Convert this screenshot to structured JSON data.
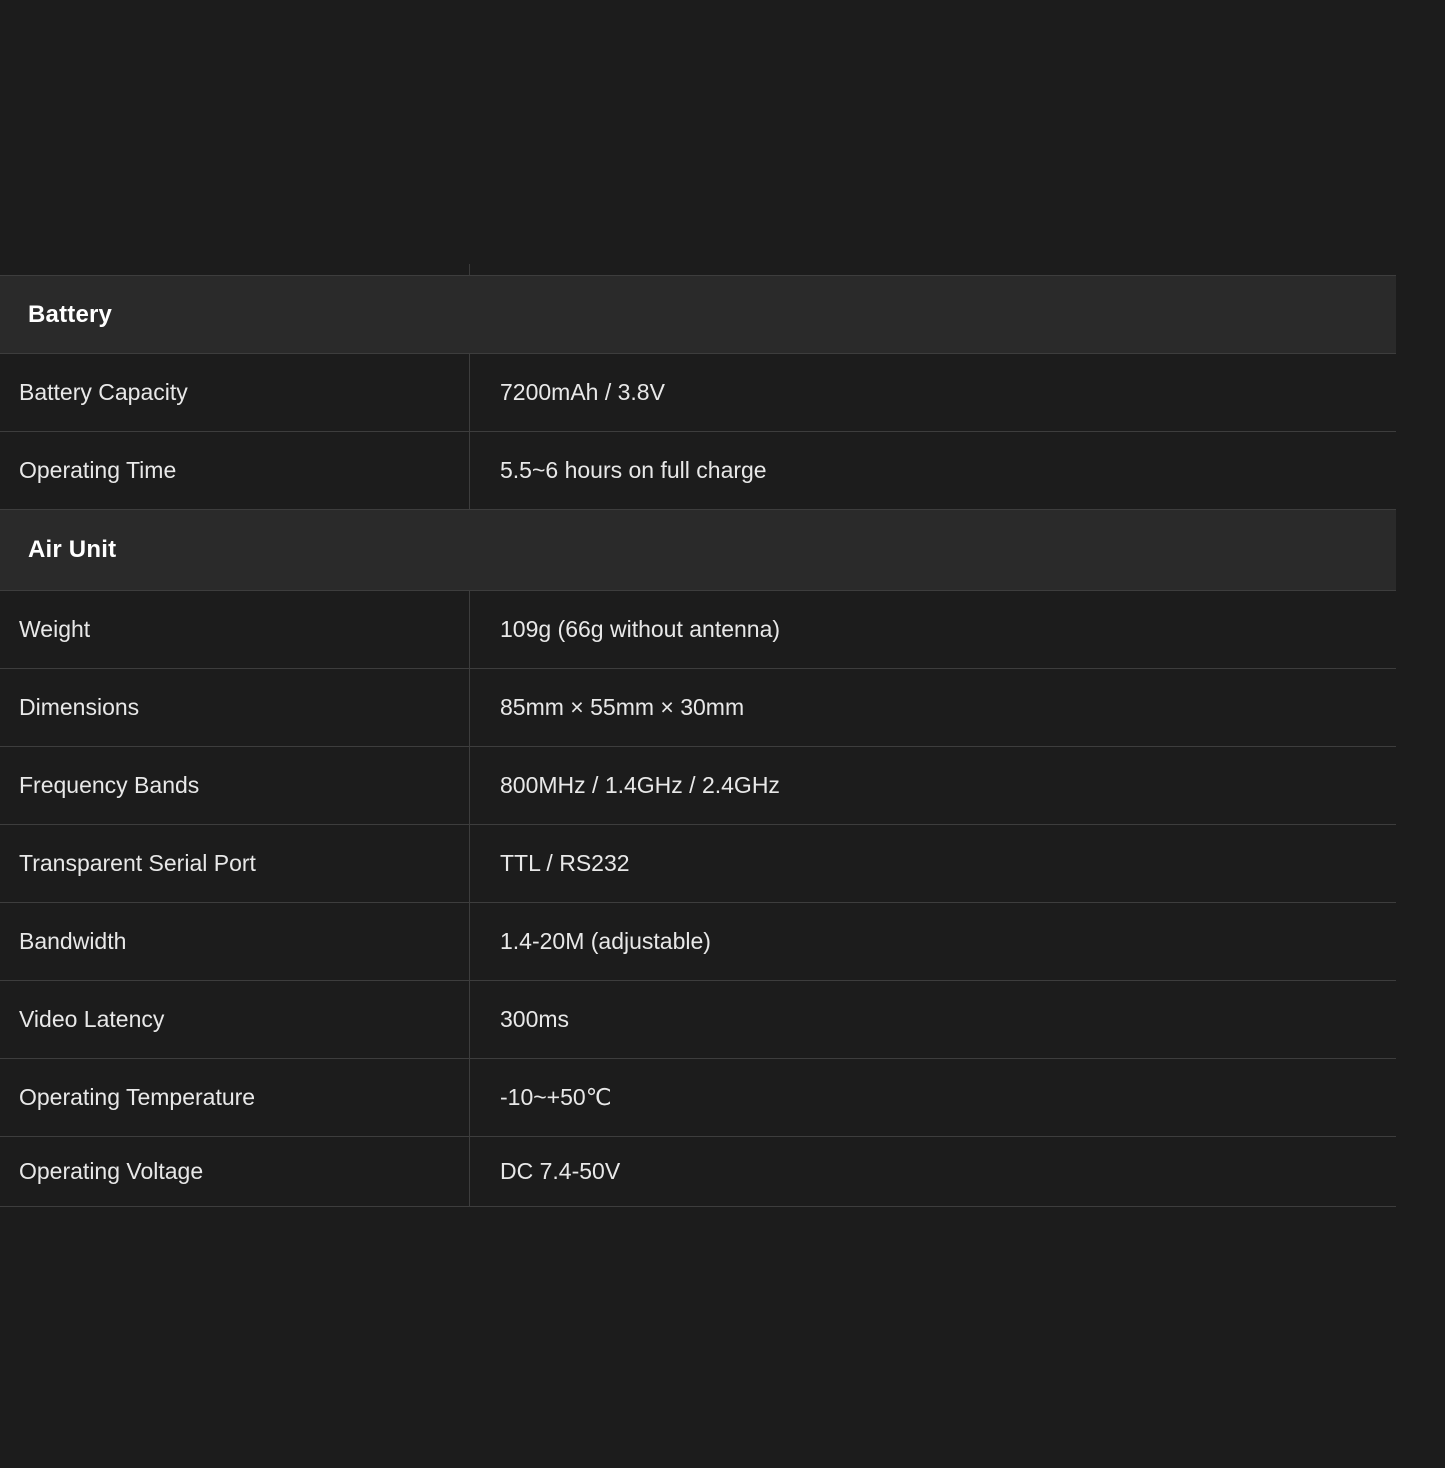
{
  "sections": [
    {
      "title": "Battery",
      "rows": [
        {
          "label": "Battery Capacity",
          "value": "7200mAh / 3.8V"
        },
        {
          "label": "Operating Time",
          "value": "5.5~6 hours on full charge"
        }
      ]
    },
    {
      "title": "Air Unit",
      "rows": [
        {
          "label": "Weight",
          "value": "109g (66g without antenna)"
        },
        {
          "label": "Dimensions",
          "value": "85mm × 55mm × 30mm"
        },
        {
          "label": "Frequency Bands",
          "value": "800MHz / 1.4GHz / 2.4GHz"
        },
        {
          "label": "Transparent Serial Port",
          "value": "TTL / RS232"
        },
        {
          "label": "Bandwidth",
          "value": "1.4-20M (adjustable)"
        },
        {
          "label": "Video Latency",
          "value": "300ms"
        },
        {
          "label": "Operating Temperature",
          "value": "-10~+50℃"
        },
        {
          "label": "Operating Voltage",
          "value": "DC 7.4-50V"
        }
      ]
    }
  ]
}
